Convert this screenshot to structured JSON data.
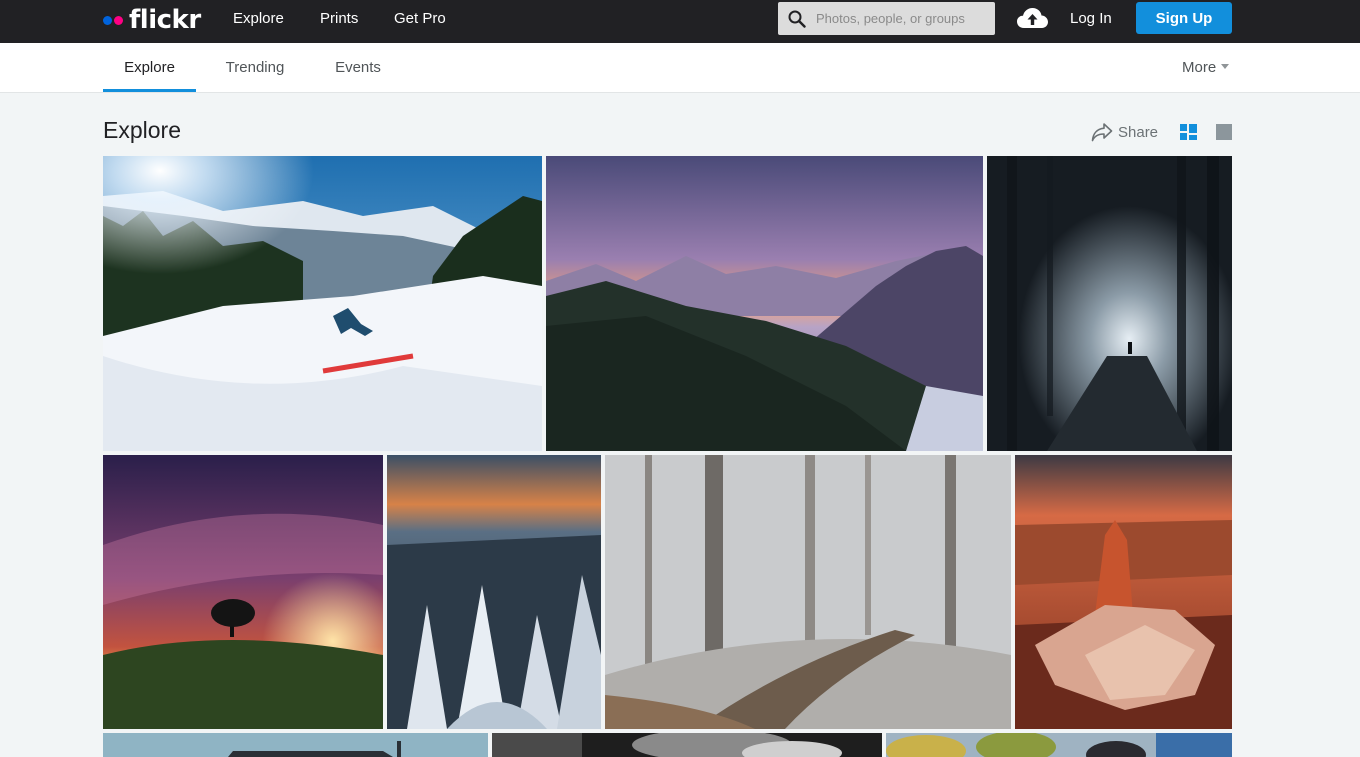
{
  "brand": {
    "wordmark": "flickr"
  },
  "topnav": {
    "items": [
      {
        "label": "Explore"
      },
      {
        "label": "Prints"
      },
      {
        "label": "Get Pro"
      }
    ],
    "search_placeholder": "Photos, people, or groups",
    "login_label": "Log In",
    "signup_label": "Sign Up"
  },
  "subnav": {
    "tabs": [
      {
        "label": "Explore",
        "active": true
      },
      {
        "label": "Trending",
        "active": false
      },
      {
        "label": "Events",
        "active": false
      }
    ],
    "more_label": "More"
  },
  "page": {
    "title": "Explore",
    "share_label": "Share"
  },
  "photos": [
    {
      "subject": "skier on snowy slope under sun"
    },
    {
      "subject": "sunset over forested mountains"
    },
    {
      "subject": "figure in misty dark forest"
    },
    {
      "subject": "milky way over lone tree"
    },
    {
      "subject": "snow-covered pine trees at dusk"
    },
    {
      "subject": "frosted winter woodland path"
    },
    {
      "subject": "red canyon rock formation"
    },
    {
      "subject": "building against sky"
    },
    {
      "subject": "black and white trees"
    },
    {
      "subject": "blurred foliage portrait"
    }
  ],
  "colors": {
    "topbar": "#212124",
    "accent": "#128fdc",
    "logo_blue": "#0063dc",
    "logo_pink": "#ff0084"
  }
}
